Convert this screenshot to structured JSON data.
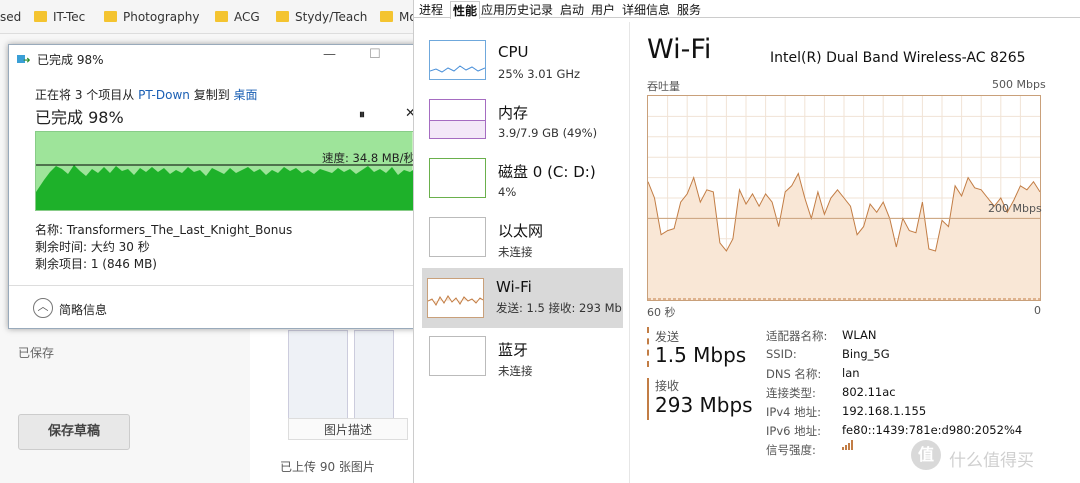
{
  "bookmarks": [
    "sed",
    "IT-Tec",
    "Photography",
    "ACG",
    "Stydy/Teach",
    "Mo"
  ],
  "blog": {
    "saved": "已保存",
    "save_draft": "保存草稿",
    "pic_desc": "图片描述",
    "uploaded": "已上传 90 张图片"
  },
  "dialog": {
    "title": "已完成 98%",
    "line_pre": "正在将 3 个项目从 ",
    "src": "PT-Down",
    "line_mid": " 复制到 ",
    "dst": "桌面",
    "progress": "已完成 98%",
    "progress_value": 0.98,
    "speed": "速度: 34.8 MB/秒",
    "name_label": "名称: ",
    "name": "Transformers_The_Last_Knight_Bonus",
    "time_label": "剩余时间: ",
    "time": "大约 30 秒",
    "items_label": "剩余项目: ",
    "items": "1 (846 MB)",
    "less_info": "简略信息",
    "pause_icon": "⏸",
    "close_icon": "✕",
    "min_icon": "—",
    "max_icon": "☐"
  },
  "taskmgr": {
    "tabs": [
      "进程",
      "性能",
      "应用历史记录",
      "启动",
      "用户",
      "详细信息",
      "服务"
    ],
    "resources": [
      {
        "name": "CPU",
        "detail": "25%  3.01 GHz"
      },
      {
        "name": "内存",
        "detail": "3.9/7.9 GB (49%)"
      },
      {
        "name": "磁盘 0 (C: D:)",
        "detail": "4%"
      },
      {
        "name": "以太网",
        "detail": "未连接"
      },
      {
        "name": "Wi-Fi",
        "detail": "发送: 1.5  接收: 293 Mb"
      },
      {
        "name": "蓝牙",
        "detail": "未连接"
      }
    ],
    "title": "Wi-Fi",
    "adapter": "Intel(R) Dual Band Wireless-AC 8265",
    "throughput": "吞吐量",
    "max": "500 Mbps",
    "mid": "200 Mbps",
    "x_left": "60 秒",
    "x_right": "0",
    "send_label": "发送",
    "send_value": "1.5 Mbps",
    "recv_label": "接收",
    "recv_value": "293 Mbps",
    "details": [
      {
        "k": "适配器名称:",
        "v": "WLAN"
      },
      {
        "k": "SSID:",
        "v": "Bing_5G"
      },
      {
        "k": "DNS 名称:",
        "v": "lan"
      },
      {
        "k": "连接类型:",
        "v": "802.11ac"
      },
      {
        "k": "IPv4 地址:",
        "v": "192.168.1.155"
      },
      {
        "k": "IPv6 地址:",
        "v": "fe80::1439:781e:d980:2052%4"
      },
      {
        "k": "信号强度:",
        "v": ""
      }
    ]
  },
  "watermark": "值 什么值得买",
  "chart_data": {
    "type": "area",
    "ylim": [
      0,
      500
    ],
    "values": [
      290,
      250,
      160,
      170,
      175,
      240,
      260,
      300,
      240,
      270,
      265,
      140,
      120,
      150,
      270,
      235,
      260,
      230,
      260,
      240,
      180,
      265,
      280,
      310,
      250,
      200,
      265,
      210,
      250,
      270,
      250,
      230,
      160,
      180,
      235,
      215,
      240,
      200,
      130,
      200,
      170,
      165,
      240,
      125,
      120,
      195,
      180,
      280,
      255,
      300,
      275,
      270,
      250,
      230,
      250,
      215,
      245,
      280,
      270,
      290,
      265
    ]
  }
}
